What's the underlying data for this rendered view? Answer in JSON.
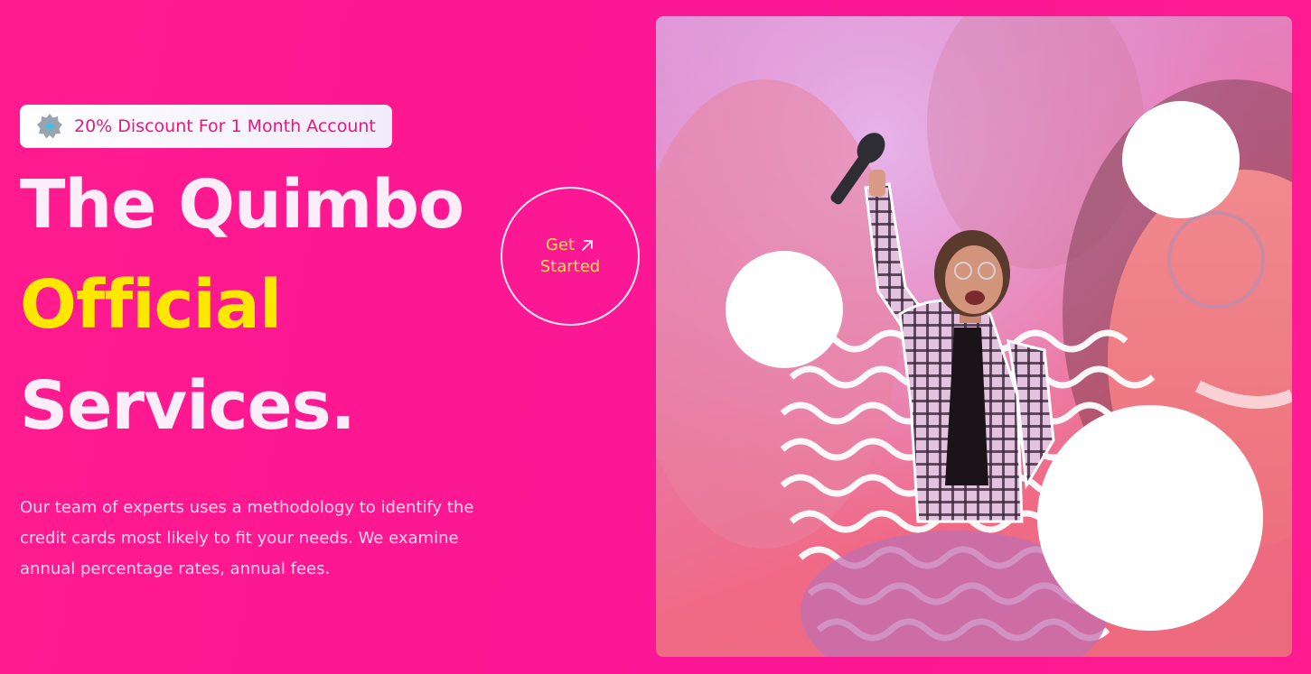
{
  "badge": {
    "text": "20% Discount For 1 Month Account",
    "icon": "sparkle-badge-icon"
  },
  "hero": {
    "title_line1": "The Quimbo",
    "title_line2": "Official",
    "title_line3": "Services.",
    "description": "Our team of experts uses a methodology to identify the credit cards most likely to fit your needs. We examine annual percentage rates, annual fees."
  },
  "cta": {
    "line1": "Get",
    "line2": "Started",
    "icon": "arrow-up-right-icon"
  },
  "image": {
    "subject": "woman-with-microphone-photo"
  },
  "colors": {
    "background": "#ff1493",
    "accent_yellow": "#ffe800",
    "title_white": "#fbeef8",
    "badge_text": "#e8177f"
  }
}
